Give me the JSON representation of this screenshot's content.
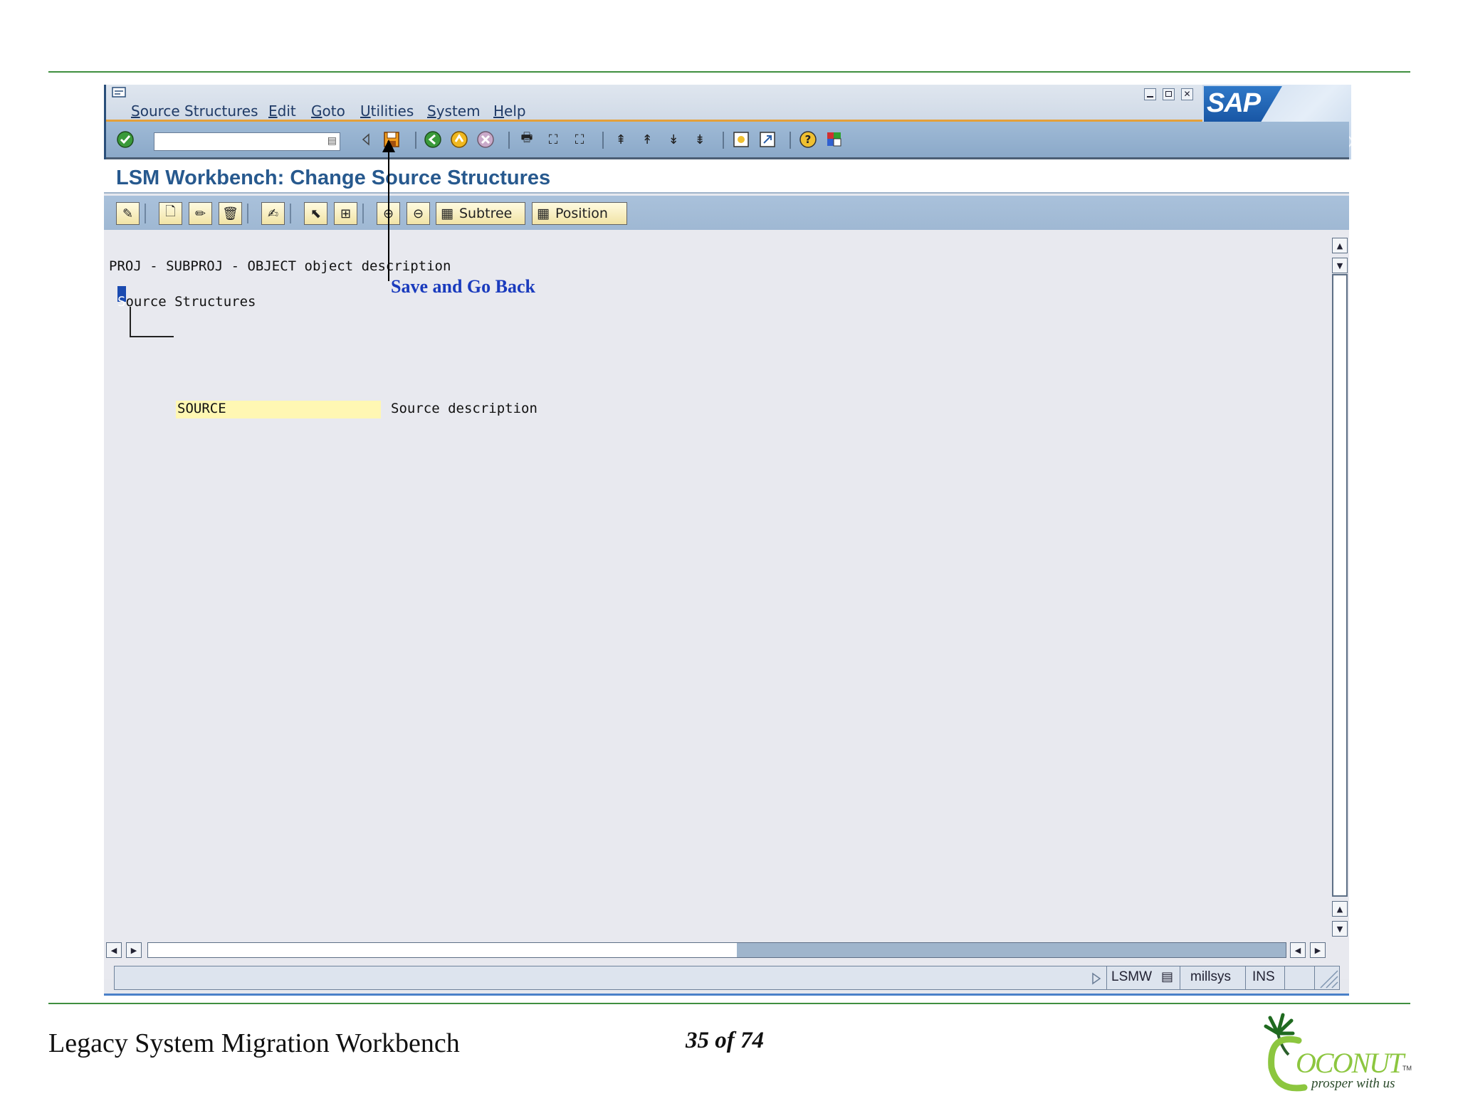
{
  "menubar": {
    "items": [
      "Source Structures",
      "Edit",
      "Goto",
      "Utilities",
      "System",
      "Help"
    ]
  },
  "window": {
    "title": "LSM Workbench: Change Source Structures",
    "logo_text": "SAP"
  },
  "command_field": {
    "value": ""
  },
  "app_toolbar": {
    "subtree_label": "Subtree",
    "position_label": "Position"
  },
  "content": {
    "header_line": "PROJ - SUBPROJ - OBJECT object description",
    "tree_root": "Source Structures",
    "tree_root_first": "S",
    "tree_root_rest": "ource Structures",
    "child_name": "SOURCE",
    "child_description": "Source description"
  },
  "annotation": {
    "text": "Save and Go Back"
  },
  "statusbar": {
    "transaction": "LSMW",
    "server": "millsys",
    "mode": "INS"
  },
  "footer": {
    "title": "Legacy System Migration Workbench",
    "page": "35 of 74",
    "logo_text": "OCONUT",
    "logo_tagline": "prosper with us",
    "logo_tm": "TM"
  },
  "colors": {
    "rule": "#3f8f3f",
    "title_blue": "#27598e",
    "annotation_blue": "#1a3bbd",
    "toolbar_blue": "#9fbad6",
    "field_yellow": "#fff7b3"
  },
  "icons": [
    "enter-icon",
    "save-icon",
    "back-icon",
    "exit-icon",
    "cancel-icon",
    "print-icon",
    "find-icon",
    "find-next-icon",
    "first-page-icon",
    "prev-page-icon",
    "next-page-icon",
    "last-page-icon",
    "new-session-icon",
    "shortcut-icon",
    "help-icon",
    "layout-icon"
  ]
}
